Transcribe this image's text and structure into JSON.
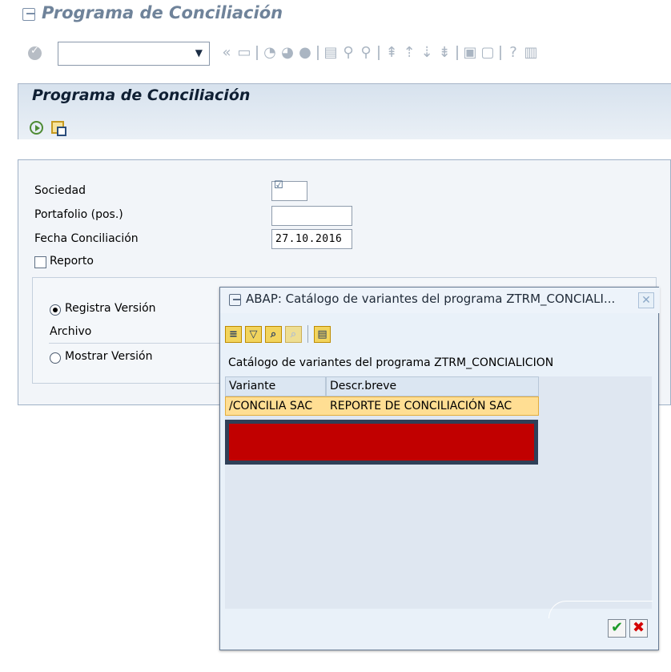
{
  "window": {
    "title": "Programa de Conciliación"
  },
  "toolbar": {
    "command_value": "",
    "icons": [
      "check-icon",
      "command-field",
      "back-icon",
      "save-icon",
      "exit-icon",
      "cancel-icon",
      "print-icon",
      "find-icon",
      "find-next-icon",
      "first-page-icon",
      "previous-page-icon",
      "next-page-icon",
      "last-page-icon",
      "new-session-icon",
      "shortcut-icon",
      "help-icon",
      "layout-icon"
    ]
  },
  "screen": {
    "title": "Programa de Conciliación",
    "icons": [
      "execute-icon",
      "copy-icon"
    ]
  },
  "form": {
    "fields": [
      {
        "label": "Sociedad",
        "value": "☑"
      },
      {
        "label": "Portafolio (pos.)",
        "value": ""
      },
      {
        "label": "Fecha Conciliación",
        "value": "27.10.2016"
      }
    ],
    "reporto_label": "Reporto",
    "reporto_checked": false,
    "radio_1": "Registra Versión",
    "archivo_label": "Archivo",
    "radio_2": "Mostrar Versión"
  },
  "dialog": {
    "title": "ABAP: Catálogo de variantes del programa ZTRM_CONCIALI...",
    "close": "✕",
    "catalog_title": "Catálogo de variantes del programa ZTRM_CONCIALICION",
    "columns": [
      "Variante",
      "Descr.breve"
    ],
    "rows": [
      {
        "variant": "/CONCILIA SAC",
        "description": "REPORTE DE CONCILIACIÓN SAC"
      }
    ],
    "toolbar_icons": [
      "sort-ascending-icon",
      "filter-icon",
      "find-icon",
      "find-next-icon",
      "print-icon"
    ],
    "buttons": {
      "ok": "✔",
      "cancel": "✖"
    }
  }
}
